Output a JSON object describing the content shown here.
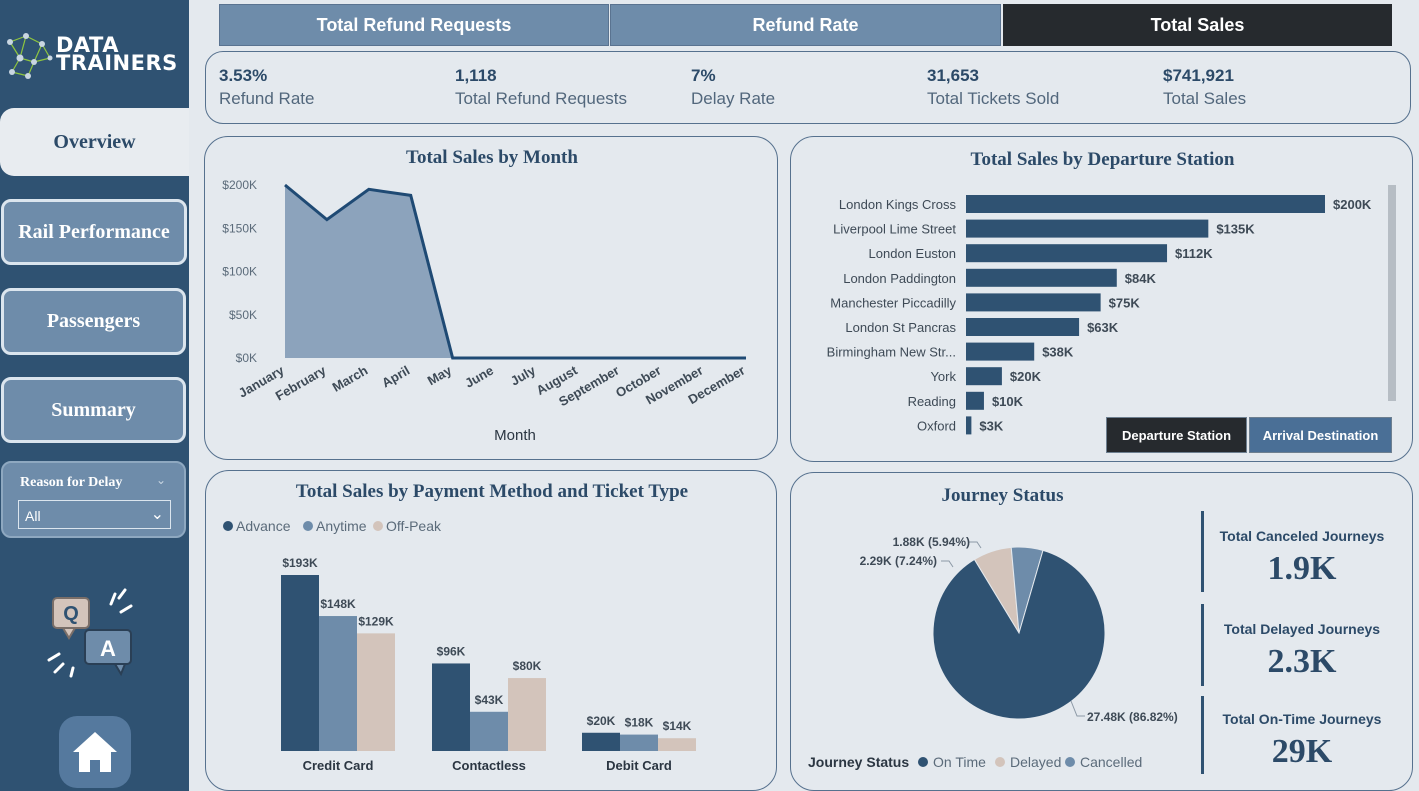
{
  "brand": {
    "line1": "DATA",
    "line2": "TRAINERS"
  },
  "nav": {
    "overview": "Overview",
    "rail": "Rail Performance",
    "passengers": "Passengers",
    "summary": "Summary"
  },
  "filter": {
    "label": "Reason for Delay",
    "value": "All"
  },
  "tabs": {
    "refunds": "Total Refund Requests",
    "rate": "Refund Rate",
    "sales": "Total Sales",
    "active": "Total Sales"
  },
  "kpis": [
    {
      "value": "3.53%",
      "label": "Refund Rate"
    },
    {
      "value": "1,118",
      "label": "Total Refund Requests"
    },
    {
      "value": "7%",
      "label": "Delay Rate"
    },
    {
      "value": "31,653",
      "label": "Total Tickets Sold"
    },
    {
      "value": "$741,921",
      "label": "Total Sales"
    }
  ],
  "chart_data": [
    {
      "type": "area",
      "title": "Total Sales by Month",
      "xlabel": "Month",
      "ylabel": "",
      "categories": [
        "January",
        "February",
        "March",
        "April",
        "May",
        "June",
        "July",
        "August",
        "September",
        "October",
        "November",
        "December"
      ],
      "values": [
        200000,
        160000,
        195000,
        188000,
        0,
        0,
        0,
        0,
        0,
        0,
        0,
        0
      ],
      "yticks": [
        "$0K",
        "$50K",
        "$100K",
        "$150K",
        "$200K"
      ],
      "ylim": [
        0,
        200000
      ],
      "grid": false,
      "colors": {
        "fill": "#8ca3bc",
        "line": "#1f4a74"
      }
    },
    {
      "type": "bar",
      "orientation": "horizontal",
      "title": "Total Sales by Departure Station",
      "categories": [
        "London Kings Cross",
        "Liverpool Lime Street",
        "London Euston",
        "London Paddington",
        "Manchester Piccadilly",
        "London St Pancras",
        "Birmingham New Str...",
        "York",
        "Reading",
        "Oxford"
      ],
      "values": [
        200000,
        135000,
        112000,
        84000,
        75000,
        63000,
        38000,
        20000,
        10000,
        3000
      ],
      "labels": [
        "$200K",
        "$135K",
        "$112K",
        "$84K",
        "$75K",
        "$63K",
        "$38K",
        "$20K",
        "$10K",
        "$3K"
      ],
      "colors": {
        "bar": "#2f5272"
      }
    },
    {
      "type": "bar",
      "title": "Total Sales by Payment Method and Ticket Type",
      "categories": [
        "Credit Card",
        "Contactless",
        "Debit Card"
      ],
      "series": [
        {
          "name": "Advance",
          "values": [
            193000,
            96000,
            20000
          ],
          "labels": [
            "$193K",
            "$96K",
            "$20K"
          ],
          "color": "#2f5272"
        },
        {
          "name": "Anytime",
          "values": [
            148000,
            43000,
            18000
          ],
          "labels": [
            "$148K",
            "$43K",
            "$18K"
          ],
          "color": "#6e8caa"
        },
        {
          "name": "Off-Peak",
          "values": [
            129000,
            80000,
            14000
          ],
          "labels": [
            "$129K",
            "$80K",
            "$14K"
          ],
          "color": "#d3c4bb"
        }
      ],
      "legend": "top-left"
    },
    {
      "type": "pie",
      "title": "Journey Status",
      "legend_title": "Journey Status",
      "legend": "bottom",
      "slices": [
        {
          "name": "On Time",
          "value": 27480,
          "label": "27.48K (86.82%)",
          "color": "#2f5272"
        },
        {
          "name": "Delayed",
          "value": 2290,
          "label": "2.29K (7.24%)",
          "color": "#d3c4bb"
        },
        {
          "name": "Cancelled",
          "value": 1880,
          "label": "1.88K (5.94%)",
          "color": "#6e8caa"
        }
      ]
    }
  ],
  "station_toggle": {
    "departure": "Departure Station",
    "arrival": "Arrival Destination",
    "active": "Departure Station"
  },
  "journey_cards": [
    {
      "label": "Total Canceled Journeys",
      "value": "1.9K"
    },
    {
      "label": "Total Delayed Journeys",
      "value": "2.3K"
    },
    {
      "label": "Total On-Time Journeys",
      "value": "29K"
    }
  ],
  "icons": {
    "qa": "qa-chat-icon",
    "home": "home-icon",
    "logo": "network-logo-icon",
    "chevron": "chevron-down-icon"
  }
}
